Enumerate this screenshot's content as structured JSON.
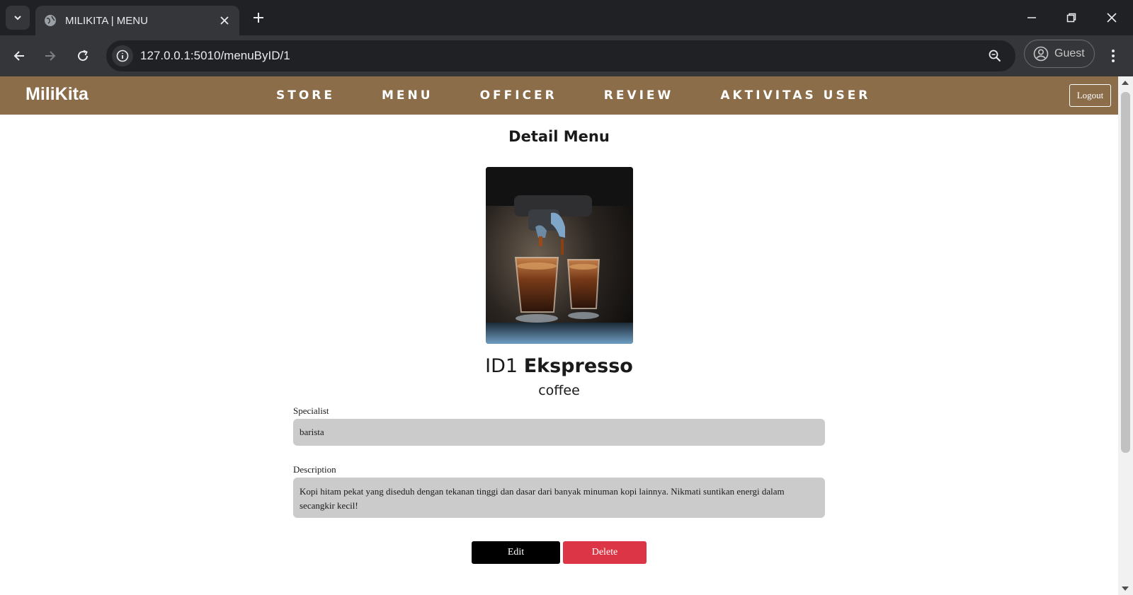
{
  "browser": {
    "tab_title": "MILIKITA | MENU",
    "url": "127.0.0.1:5010/menuByID/1",
    "profile_label": "Guest"
  },
  "site": {
    "brand": "MiliKita",
    "nav": [
      "STORE",
      "MENU",
      "OFFICER",
      "REVIEW",
      "AKTIVITAS USER"
    ],
    "logout_label": "Logout"
  },
  "detail": {
    "title": "Detail Menu",
    "id_label": "ID1",
    "name": "Ekspresso",
    "category": "coffee",
    "specialist_label": "Specialist",
    "specialist_value": "barista",
    "description_label": "Description",
    "description_value": "Kopi hitam pekat yang diseduh dengan tekanan tinggi dan dasar dari banyak minuman kopi lainnya. Nikmati suntikan energi dalam secangkir kecil!",
    "edit_label": "Edit",
    "delete_label": "Delete"
  },
  "colors": {
    "navbar": "#8b6d4a",
    "delete": "#dc3545",
    "field_bg": "#cbcbcb"
  }
}
